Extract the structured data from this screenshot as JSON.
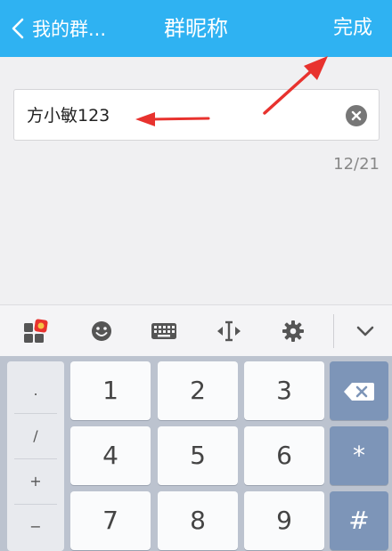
{
  "header": {
    "back_label": "我的群...",
    "title": "群昵称",
    "done_label": "完成"
  },
  "input": {
    "value": "方小敏123",
    "counter": "12/21"
  },
  "toolbar": {
    "icons": [
      "app-grid-icon",
      "emoji-icon",
      "keyboard-icon",
      "cursor-icon",
      "settings-icon",
      "collapse-icon"
    ]
  },
  "keyboard": {
    "symbols": [
      ".",
      "/",
      "+",
      "−"
    ],
    "row1": [
      "1",
      "2",
      "3"
    ],
    "row2": [
      "4",
      "5",
      "6",
      "*"
    ],
    "row3": [
      "7",
      "8",
      "9",
      "#"
    ]
  },
  "colors": {
    "header": "#2fb2f2",
    "annotation": "#e8322e",
    "fn_key": "#7d95b8"
  }
}
